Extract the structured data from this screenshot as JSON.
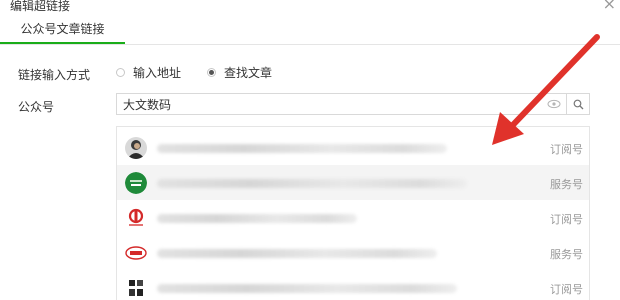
{
  "dialog": {
    "title": "编辑超链接",
    "close_icon": "close-icon"
  },
  "tabs": [
    {
      "label": "公众号文章链接",
      "active": true
    }
  ],
  "form": {
    "link_input_method_label": "链接输入方式",
    "options": [
      {
        "label": "输入地址",
        "checked": false
      },
      {
        "label": "查找文章",
        "checked": true
      }
    ],
    "account_label": "公众号",
    "search_value": "大文数码",
    "search_placeholder": ""
  },
  "results": [
    {
      "avatar": "person-photo-avatar",
      "name_blurred": true,
      "type": "订阅号"
    },
    {
      "avatar": "green-circle-logo-avatar",
      "name_blurred": true,
      "type": "服务号"
    },
    {
      "avatar": "red-logo-avatar",
      "name_blurred": true,
      "type": "订阅号"
    },
    {
      "avatar": "red-text-logo-avatar",
      "name_blurred": true,
      "type": "服务号"
    },
    {
      "avatar": "black-text-logo-avatar",
      "name_blurred": true,
      "type": "订阅号"
    }
  ],
  "annotation": {
    "arrow_color": "#e0322b"
  },
  "colors": {
    "accent_green": "#1aad19",
    "tag_gray": "#999999"
  }
}
